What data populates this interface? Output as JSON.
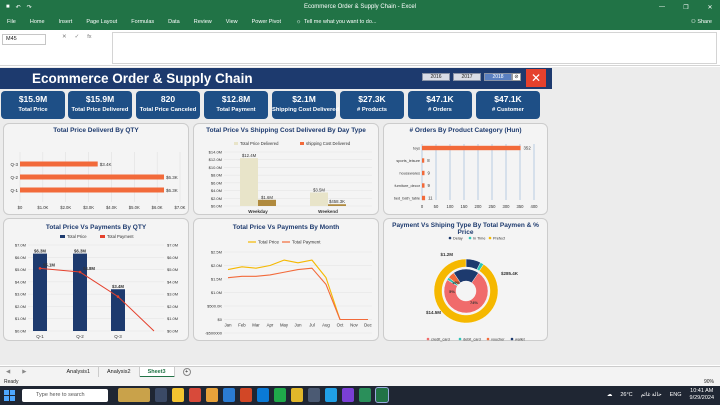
{
  "window": {
    "title": "Ecommerce Order & Supply Chain - Excel",
    "controls": [
      "—",
      "❐",
      "✕"
    ]
  },
  "ribbon": {
    "tabs": [
      "File",
      "Home",
      "Insert",
      "Page Layout",
      "Formulas",
      "Data",
      "Review",
      "View",
      "Power Pivot"
    ],
    "tell_me": "Tell me what you want to do...",
    "share": "Share"
  },
  "formula_bar": {
    "name_box": "M45",
    "fx": "fx",
    "cancel": "✕",
    "enter": "✓"
  },
  "dashboard": {
    "title": "Ecommerce Order & Supply Chain",
    "years": [
      "2016",
      "2017",
      "2018"
    ],
    "selected_year": "2018",
    "close": "✕",
    "kpis": [
      {
        "value": "$15.9M",
        "label": "Total Price"
      },
      {
        "value": "$15.9M",
        "label": "Total Price Delivered"
      },
      {
        "value": "820",
        "label": "Total Price Canceled"
      },
      {
        "value": "$12.8M",
        "label": "Total Payment"
      },
      {
        "value": "$2.1M",
        "label": "Shipping Cost Delivered"
      },
      {
        "value": "$27.3K",
        "label": "# Products"
      },
      {
        "value": "$47.1K",
        "label": "# Orders"
      },
      {
        "value": "$47.1K",
        "label": "# Customer"
      }
    ]
  },
  "colors": {
    "header": "#1d3a6e",
    "kpi": "#1e4f86",
    "orange": "#f26a3a",
    "navy": "#1d3a6e",
    "beige": "#e8e4c9",
    "brown": "#b08a3e",
    "gold": "#f5b800",
    "red": "#e5412d",
    "teal": "#2ec4b6",
    "pink": "#f06b6b"
  },
  "chart_data": [
    {
      "type": "bar",
      "title": "Total Price Deliverd By QTY",
      "categories": [
        "Q-1",
        "Q-2",
        "Q-3"
      ],
      "values": [
        6.3,
        6.3,
        3.4
      ],
      "data_labels": [
        "$6.3K",
        "$6.3K",
        "$3.4K"
      ],
      "x_ticks": [
        "$0",
        "$1.0K",
        "$2.0K",
        "$3.0K",
        "$4.0K",
        "$5.0K",
        "$6.0K",
        "$7.0K"
      ],
      "xlim": [
        0,
        7
      ]
    },
    {
      "type": "bar",
      "title": "Total Price Vs  Shipping Cost Delivered By Day Type",
      "categories": [
        "Weekday",
        "Weekend"
      ],
      "series": [
        {
          "name": "Total Price Delivered",
          "values": [
            12.4,
            3.5
          ],
          "labels": [
            "$12.4M",
            "$3.5M"
          ]
        },
        {
          "name": "shipping Cost Delivered",
          "values": [
            1.6,
            0.46
          ],
          "labels": [
            "$1.6M",
            "$458.3K"
          ]
        }
      ],
      "y_ticks": [
        "$0.0M",
        "$2.0M",
        "$4.0M",
        "$6.0M",
        "$8.0M",
        "$10.0M",
        "$12.0M",
        "$14.0M"
      ],
      "ylim": [
        0,
        14
      ]
    },
    {
      "type": "bar",
      "title": "# Orders By Product Category (Hun)",
      "categories": [
        "toys",
        "sports_leisure",
        "housewares",
        "furniture_decor",
        "bed_bath_table"
      ],
      "values": [
        352,
        8,
        9,
        9,
        11
      ],
      "x_ticks": [
        "0",
        "50",
        "100",
        "150",
        "200",
        "250",
        "300",
        "350",
        "400"
      ],
      "xlim": [
        0,
        400
      ]
    },
    {
      "type": "bar",
      "title": "Total Price Vs Payments By QTY",
      "categories": [
        "Q-1",
        "Q-2",
        "Q-3"
      ],
      "series": [
        {
          "name": "Total Price",
          "values": [
            6.3,
            6.3,
            3.4
          ],
          "labels": [
            "$6.3M",
            "$6.3M",
            "$3.4M"
          ]
        },
        {
          "name": "Total Payment",
          "values": [
            5.1,
            4.8,
            2.8
          ],
          "labels": [
            "$5.1M",
            "$4.8M",
            ""
          ]
        }
      ],
      "y_ticks": [
        "$0.0M",
        "$1.0M",
        "$2.0M",
        "$3.0M",
        "$4.0M",
        "$5.0M",
        "$6.0M",
        "$7.0M"
      ],
      "ylim": [
        0,
        7
      ]
    },
    {
      "type": "line",
      "title": "Total Price Vs Payments By Month",
      "categories": [
        "Jan",
        "Feb",
        "Mar",
        "Apr",
        "May",
        "Jun",
        "Jul",
        "Aug",
        "Oct",
        "Nov",
        "Dec"
      ],
      "series": [
        {
          "name": "Total Price",
          "values": [
            1.85,
            1.95,
            1.9,
            2.0,
            2.2,
            2.1,
            2.2,
            1.55,
            0,
            0,
            0
          ]
        },
        {
          "name": "Total Payment",
          "values": [
            1.55,
            1.6,
            1.6,
            1.65,
            1.75,
            1.85,
            1.9,
            1.3,
            0,
            0,
            0
          ]
        }
      ],
      "y_ticks": [
        "-$500000",
        "$0",
        "$500.0K",
        "$1.0M",
        "$1.5M",
        "$2.0M",
        "$2.5M"
      ],
      "ylim": [
        -0.5,
        2.5
      ]
    },
    {
      "type": "pie",
      "title": "Payment Vs Shiping Type By Total Paymen & % Price",
      "legend_outer": [
        "Delay",
        "In Time",
        "Prefect"
      ],
      "legend_inner": [
        "credit_card",
        "debit_card",
        "voucher",
        "wallet"
      ],
      "outer": [
        {
          "name": "Delay",
          "value": 1.2,
          "label": "$1.2M"
        },
        {
          "name": "In Time",
          "value": 0.285,
          "label": "$285.4K"
        },
        {
          "name": "Prefect",
          "value": 14.5,
          "label": "$14.5M"
        }
      ],
      "inner": [
        {
          "name": "credit_card",
          "value": 74,
          "label": "74%"
        },
        {
          "name": "debit_card",
          "value": 2,
          "label": ""
        },
        {
          "name": "voucher",
          "value": 5,
          "label": "5%"
        },
        {
          "name": "wallet",
          "value": 19,
          "label": "19%"
        }
      ]
    }
  ],
  "sheets": [
    "Analysis1",
    "Analysis2",
    "Sheet3"
  ],
  "active_sheet": "Sheet3",
  "status": {
    "text": "Ready",
    "zoom": "90%"
  },
  "taskbar": {
    "search": "Type here to search",
    "temp": "26°C",
    "weather": "حالة غائم",
    "lang": "ENG",
    "time": "10:41 AM",
    "date": "9/29/2024"
  }
}
